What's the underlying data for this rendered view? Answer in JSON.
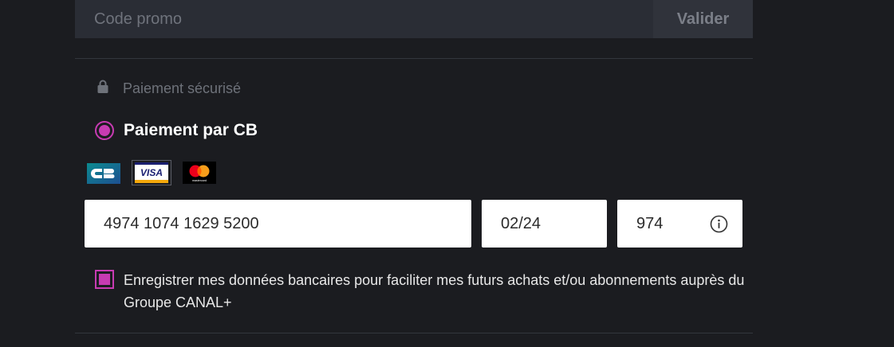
{
  "promo": {
    "placeholder": "Code promo",
    "button_label": "Valider"
  },
  "secure": {
    "icon": "lock-icon",
    "label": "Paiement sécurisé"
  },
  "payment_method": {
    "label": "Paiement par CB",
    "selected": true,
    "accent_color": "#c73bb2"
  },
  "card_logos": [
    {
      "name": "CB",
      "text": "CB"
    },
    {
      "name": "Visa",
      "text": "VISA"
    },
    {
      "name": "Mastercard",
      "text": "mastercard"
    }
  ],
  "card_form": {
    "card_number": "4974 1074 1629 5200",
    "expiry": "02/24",
    "cvv": "974",
    "cvv_icon": "info-icon"
  },
  "save_card": {
    "checked": true,
    "label": "Enregistrer mes données bancaires pour faciliter mes futurs achats et/ou abonnements auprès du Groupe CANAL+"
  }
}
